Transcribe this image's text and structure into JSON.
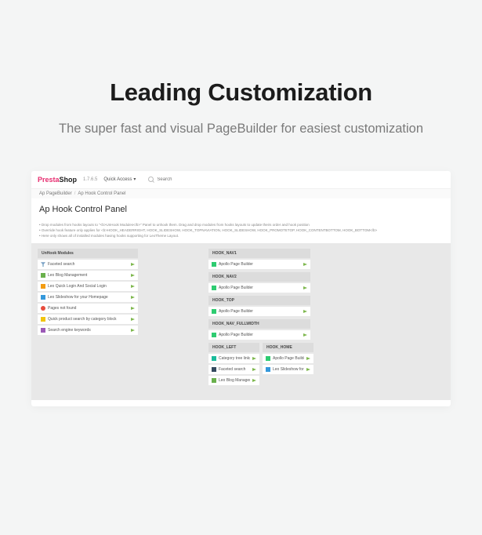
{
  "hero": {
    "heading": "Leading Customization",
    "subheading": "The super fast and visual PageBuilder for easiest customization"
  },
  "topbar": {
    "logo_presta": "Presta",
    "logo_shop": "Shop",
    "version": "1.7.6.5",
    "quick_access": "Quick Access",
    "search_placeholder": "Search"
  },
  "breadcrumb": {
    "parent": "Ap PageBuilder",
    "current": "Ap Hook Control Panel"
  },
  "panel_title": "Ap Hook Control Panel",
  "hints": [
    "• Drop modules from hooks layouts to \"<b>UnHook Modules</b>\" Panel to unhook them. Drag and drop modules from hooks layouts to update theirs order and hook position",
    "• Override hook feature only applies for <b>HOOK_HEADERRIGHT, HOOK_SLIDESHOW, HOOK_TOPNAVIATION, HOOK_SLIDESHOW, HOOK_PROMOTETOP, HOOK_CONTENTBOTTOM, HOOK_BOTTOM</b>",
    "• Here only shows all of installed modules having hooks supporting for LeoTheme Layout."
  ],
  "sections": {
    "unhook": "UnHook Modules",
    "nav1": "HOOK_NAV1",
    "nav2": "HOOK_NAV2",
    "top": "HOOK_TOP",
    "nav_full": "HOOK_NAV_FULLWIDTH",
    "left": "HOOK_LEFT",
    "home": "HOOK_HOME"
  },
  "modules": {
    "faceted": "Faceted search",
    "blog": "Leo Blog Management",
    "login": "Leo Quick Login And Social Login",
    "slide": "Leo Slideshow for your Homepage",
    "pages": "Pages not found",
    "quick": "Quick product search by category block",
    "seo": "Search engine keywords",
    "apb": "Apollo Page Builder",
    "cat": "Category tree links",
    "fac2": "Faceted search",
    "blog2": "Leo Blog Management",
    "apb2": "Apollo Page Builder",
    "slide2": "Leo Slideshow for your Homepage"
  }
}
